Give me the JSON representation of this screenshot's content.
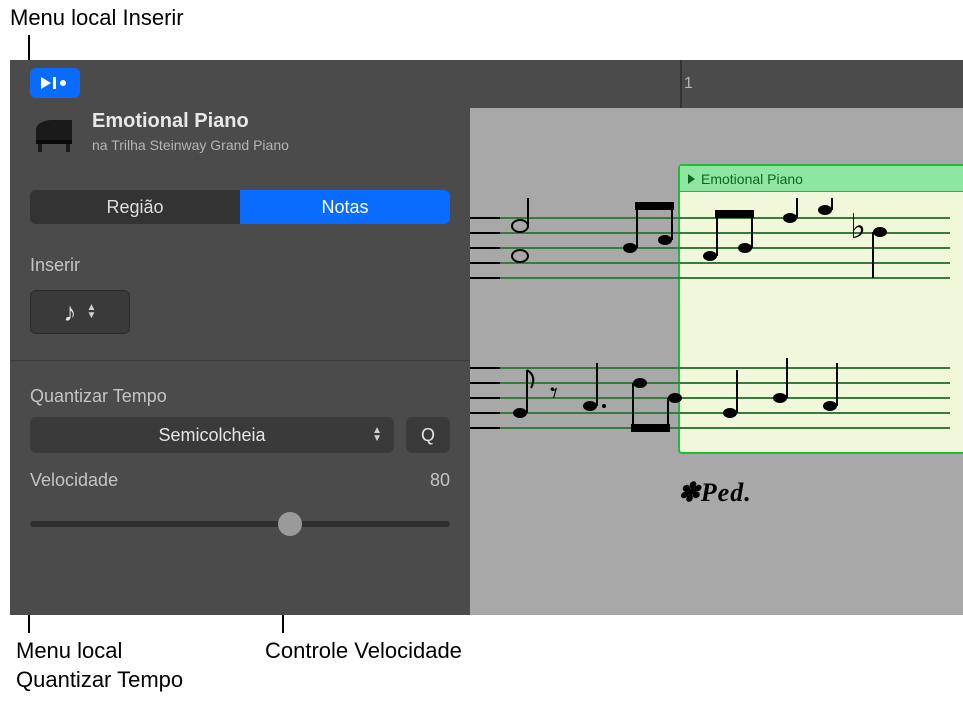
{
  "callouts": {
    "top": "Menu local Inserir",
    "bottom_left_line1": "Menu local",
    "bottom_left_line2": "Quantizar Tempo",
    "bottom_mid": "Controle Velocidade"
  },
  "track": {
    "title": "Emotional Piano",
    "subtitle": "na Trilha Steinway Grand Piano"
  },
  "tabs": {
    "region": "Região",
    "notes": "Notas"
  },
  "insert": {
    "label": "Inserir",
    "note_glyph": "♪"
  },
  "quantize": {
    "label": "Quantizar Tempo",
    "value": "Semicolcheia",
    "q_button": "Q"
  },
  "velocity": {
    "label": "Velocidade",
    "value": "80"
  },
  "ruler": {
    "bar1": "1"
  },
  "region": {
    "name": "Emotional Piano"
  },
  "ped": "✽Ped."
}
